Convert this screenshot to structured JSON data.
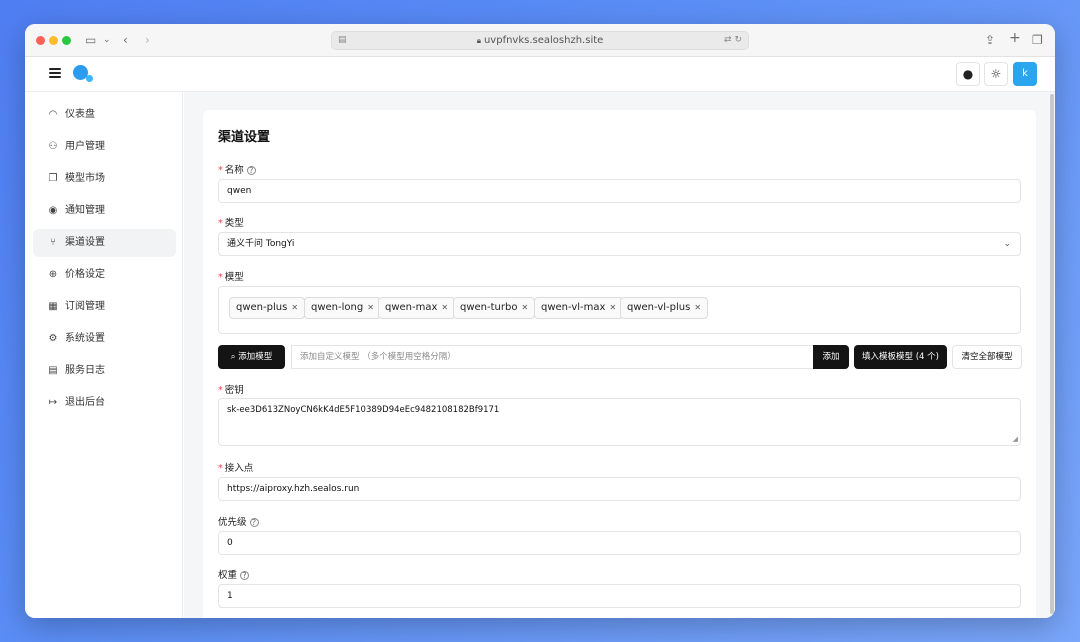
{
  "browser": {
    "url": "uvpfnvks.sealoshzh.site"
  },
  "header": {
    "avatar_letter": "k"
  },
  "sidebar": {
    "items": [
      {
        "label": "仪表盘",
        "icon": "gauge-icon",
        "glyph": "◠"
      },
      {
        "label": "用户管理",
        "icon": "users-icon",
        "glyph": "⚇"
      },
      {
        "label": "模型市场",
        "icon": "copy-icon",
        "glyph": "❐"
      },
      {
        "label": "通知管理",
        "icon": "radio-icon",
        "glyph": "◉"
      },
      {
        "label": "渠道设置",
        "icon": "git-branch-icon",
        "glyph": "⑂"
      },
      {
        "label": "价格设定",
        "icon": "coins-icon",
        "glyph": "⊕"
      },
      {
        "label": "订阅管理",
        "icon": "calendar-icon",
        "glyph": "▦"
      },
      {
        "label": "系统设置",
        "icon": "gear-icon",
        "glyph": "⚙"
      },
      {
        "label": "服务日志",
        "icon": "file-log-icon",
        "glyph": "▤"
      },
      {
        "label": "退出后台",
        "icon": "logout-icon",
        "glyph": "↦"
      }
    ],
    "active_index": 4
  },
  "form": {
    "title": "渠道设置",
    "name_label": "名称",
    "name_value": "qwen",
    "type_label": "类型",
    "type_value": "通义千问 TongYi",
    "models_label": "模型",
    "models": [
      "qwen-plus",
      "qwen-long",
      "qwen-max",
      "qwen-turbo",
      "qwen-vl-max",
      "qwen-vl-plus"
    ],
    "add_model_button": "添加模型",
    "custom_model_placeholder": "添加自定义模型 （多个模型用空格分隔）",
    "add_button": "添加",
    "fill_template_button": "填入模板模型 (4 个)",
    "clear_all_button": "清空全部模型",
    "key_label": "密钥",
    "key_value": "sk-ee3D613ZNoyCN6kK4dE5F10389D94eEc9482108182Bf9171",
    "endpoint_label": "接入点",
    "endpoint_value": "https://aiproxy.hzh.sealos.run",
    "priority_label": "优先级",
    "priority_value": "0",
    "weight_label": "权重",
    "weight_value": "1"
  }
}
